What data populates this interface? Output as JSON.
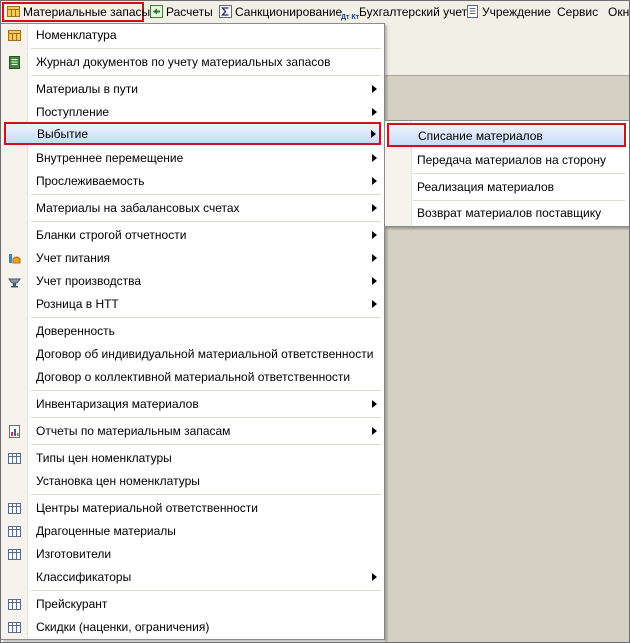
{
  "menubar": {
    "items": [
      {
        "label": "Материальные запасы",
        "icon": "table-icon"
      },
      {
        "label": "Расчеты",
        "icon": "calc-icon"
      },
      {
        "label": "Санкционирование",
        "icon": "sigma-icon"
      },
      {
        "label": "Бухгалтерский учет",
        "icon": "dt-kt-icon",
        "icon_text": "Дт Кт"
      },
      {
        "label": "Учреждение",
        "icon": "document-icon"
      },
      {
        "label": "Сервис"
      },
      {
        "label": "Окн"
      }
    ]
  },
  "menu": {
    "items": [
      {
        "label": "Номенклатура",
        "icon": "table-icon"
      },
      {
        "label": "Журнал документов по учету материальных запасов",
        "icon": "journal-icon"
      },
      {
        "label": "Материалы в пути",
        "submenu": true
      },
      {
        "label": "Поступление",
        "submenu": true
      },
      {
        "label": "Выбытие",
        "submenu": true,
        "selected": true
      },
      {
        "label": "Внутреннее перемещение",
        "submenu": true
      },
      {
        "label": "Прослеживаемость",
        "submenu": true
      },
      {
        "label": "Материалы на забалансовых счетах",
        "submenu": true
      },
      {
        "label": "Бланки строгой отчетности",
        "submenu": true
      },
      {
        "label": "Учет питания",
        "submenu": true,
        "icon": "food-icon"
      },
      {
        "label": "Учет производства",
        "submenu": true,
        "icon": "production-icon"
      },
      {
        "label": "Розница в НТТ",
        "submenu": true
      },
      {
        "label": "Доверенность"
      },
      {
        "label": "Договор об индивидуальной материальной ответственности"
      },
      {
        "label": "Договор о коллективной материальной ответственности"
      },
      {
        "label": "Инвентаризация материалов",
        "submenu": true
      },
      {
        "label": "Отчеты по материальным запасам",
        "submenu": true,
        "icon": "report-icon"
      },
      {
        "label": "Типы цен номенклатуры",
        "icon": "grid-icon"
      },
      {
        "label": "Установка цен номенклатуры"
      },
      {
        "label": "Центры материальной ответственности",
        "icon": "grid-icon"
      },
      {
        "label": "Драгоценные материалы",
        "icon": "grid-icon"
      },
      {
        "label": "Изготовители",
        "icon": "grid-icon"
      },
      {
        "label": "Классификаторы",
        "submenu": true
      },
      {
        "label": "Прейскурант",
        "icon": "grid-icon"
      },
      {
        "label": "Скидки (наценки, ограничения)",
        "icon": "grid-icon"
      }
    ]
  },
  "submenu": {
    "items": [
      {
        "label": "Списание материалов",
        "selected": true
      },
      {
        "label": "Передача материалов на сторону"
      },
      {
        "label": "Реализация материалов"
      },
      {
        "label": "Возврат материалов поставщику"
      }
    ]
  },
  "colors": {
    "highlight_border": "#d0101a",
    "selection": "#c6dbf7",
    "workspace": "#d4d0c3"
  }
}
